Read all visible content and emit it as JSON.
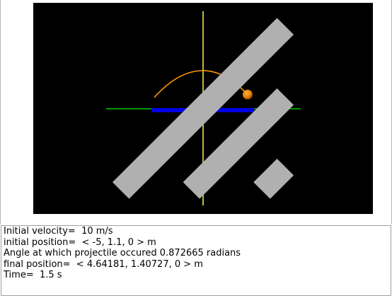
{
  "scene": {
    "background": "#000000",
    "axis_x_color": "#00c800",
    "axis_y_color": "#e6dc46",
    "platform_color": "#0000e6",
    "trail_color": "#ff9900",
    "ball_color": "#e07800",
    "origin_marker_color": "#8c8c8c",
    "resize_icon": "resize-grip-icon"
  },
  "output": {
    "lines": [
      "Initial velocity=  10 m/s",
      "initial position=  < -5, 1.1, 0 > m",
      "Angle at which projectile occured 0.872665 radians",
      "final position=  < 4.64181, 1.40727, 0 > m",
      "Time=  1.5 s"
    ]
  }
}
